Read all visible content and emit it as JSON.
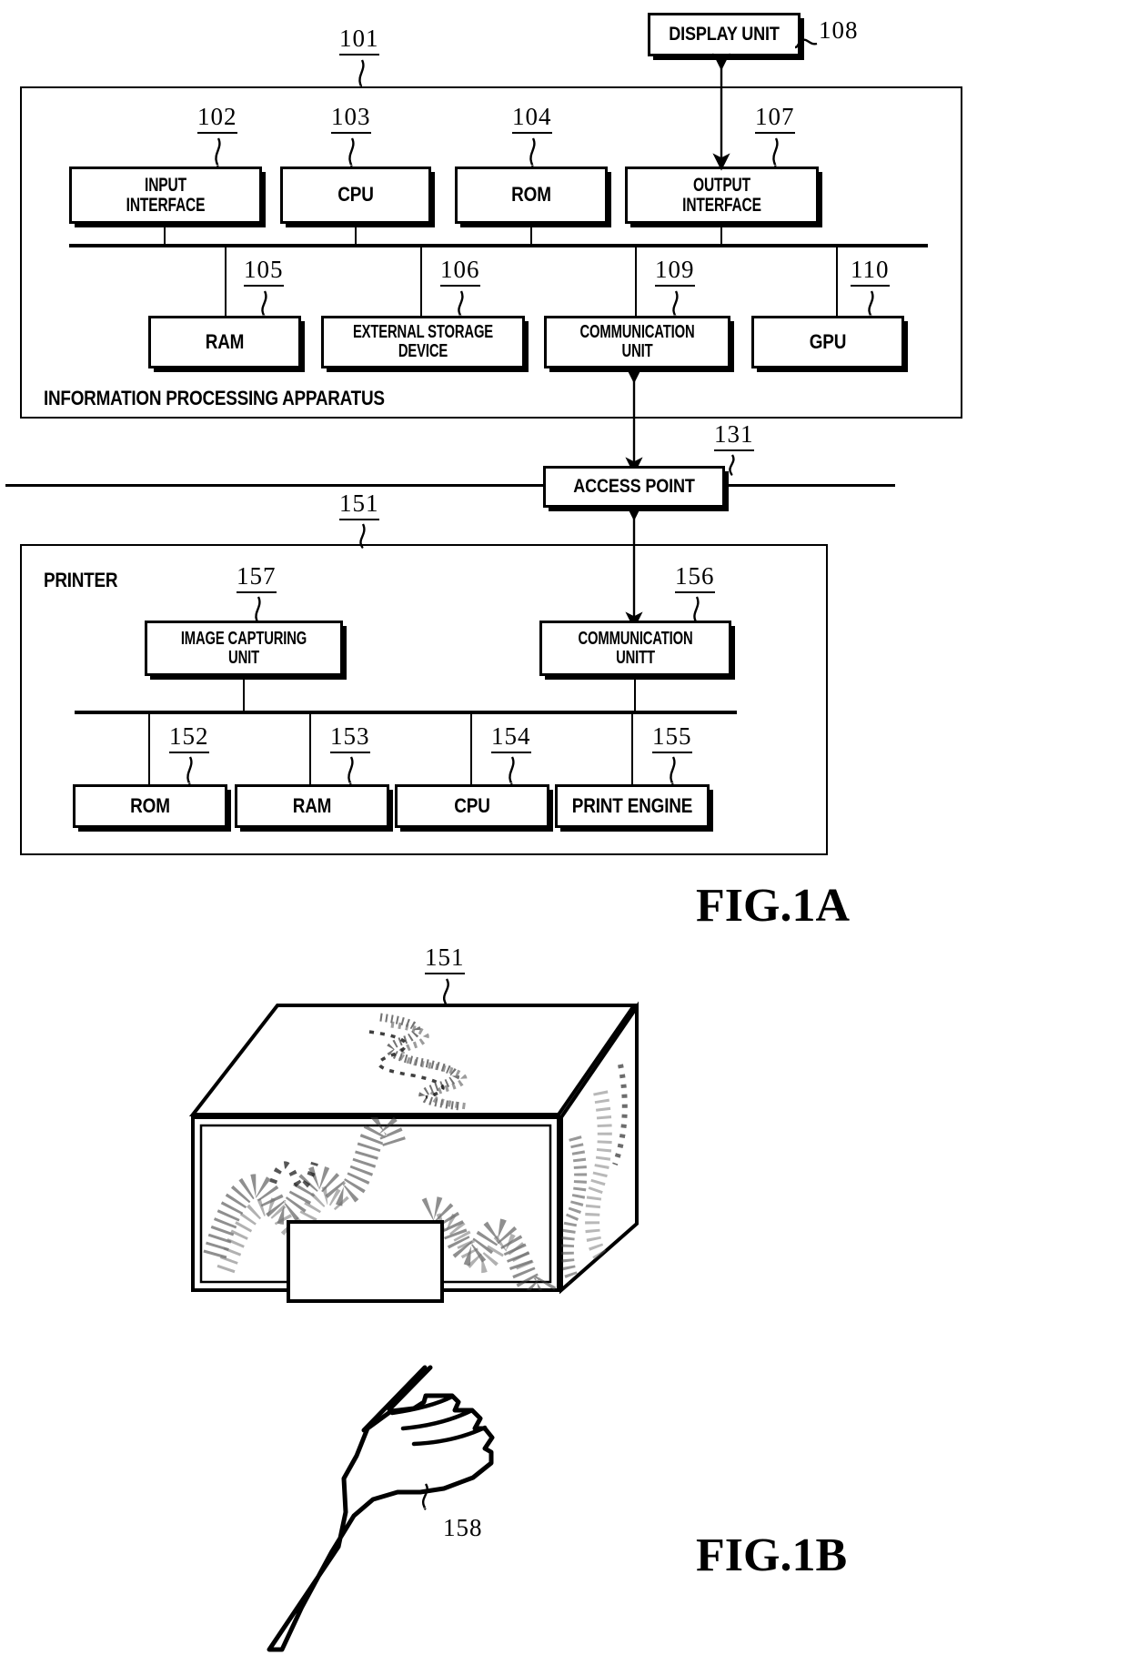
{
  "figures": [
    {
      "id": "fig-1a",
      "caption": "FIG.1A"
    },
    {
      "id": "fig-1b",
      "caption": "FIG.1B"
    }
  ],
  "fig1a": {
    "caption": "FIG.1A",
    "system_label": "INFORMATION PROCESSING APPARATUS",
    "system_ref": "101",
    "printer_label": "PRINTER",
    "printer_ref": "151",
    "display_unit": {
      "label": "DISPLAY UNIT",
      "ref": "108"
    },
    "access_point": {
      "label": "ACCESS POINT",
      "ref": "131"
    },
    "host_top_row": [
      {
        "label": "INPUT INTERFACE",
        "lines": [
          "INPUT",
          "INTERFACE"
        ],
        "ref": "102"
      },
      {
        "label": "CPU",
        "lines": [
          "CPU"
        ],
        "ref": "103"
      },
      {
        "label": "ROM",
        "lines": [
          "ROM"
        ],
        "ref": "104"
      },
      {
        "label": "OUTPUT INTERFACE",
        "lines": [
          "OUTPUT",
          "INTERFACE"
        ],
        "ref": "107"
      }
    ],
    "host_bottom_row": [
      {
        "label": "RAM",
        "lines": [
          "RAM"
        ],
        "ref": "105"
      },
      {
        "label": "EXTERNAL STORAGE DEVICE",
        "lines": [
          "EXTERNAL STORAGE",
          "DEVICE"
        ],
        "ref": "106"
      },
      {
        "label": "COMMUNICATION UNIT",
        "lines": [
          "COMMUNICATION",
          "UNIT"
        ],
        "ref": "109"
      },
      {
        "label": "GPU",
        "lines": [
          "GPU"
        ],
        "ref": "110"
      }
    ],
    "printer_top_row": [
      {
        "label": "IMAGE CAPTURING UNIT",
        "lines": [
          "IMAGE CAPTURING",
          "UNIT"
        ],
        "ref": "157"
      },
      {
        "label": "COMMUNICATION UNITT",
        "lines": [
          "COMMUNICATION",
          "UNITT"
        ],
        "ref": "156"
      }
    ],
    "printer_bottom_row": [
      {
        "label": "ROM",
        "lines": [
          "ROM"
        ],
        "ref": "152"
      },
      {
        "label": "RAM",
        "lines": [
          "RAM"
        ],
        "ref": "153"
      },
      {
        "label": "CPU",
        "lines": [
          "CPU"
        ],
        "ref": "154"
      },
      {
        "label": "PRINT ENGINE",
        "lines": [
          "PRINT ENGINE"
        ],
        "ref": "155"
      }
    ]
  },
  "fig1b": {
    "caption": "FIG.1B",
    "printer_ref": "151",
    "platen_ref": "158",
    "description": "perspective view of printer enclosure with a hand placed on the platen window"
  },
  "colors": {
    "ink": "#000000",
    "paper": "#ffffff"
  }
}
